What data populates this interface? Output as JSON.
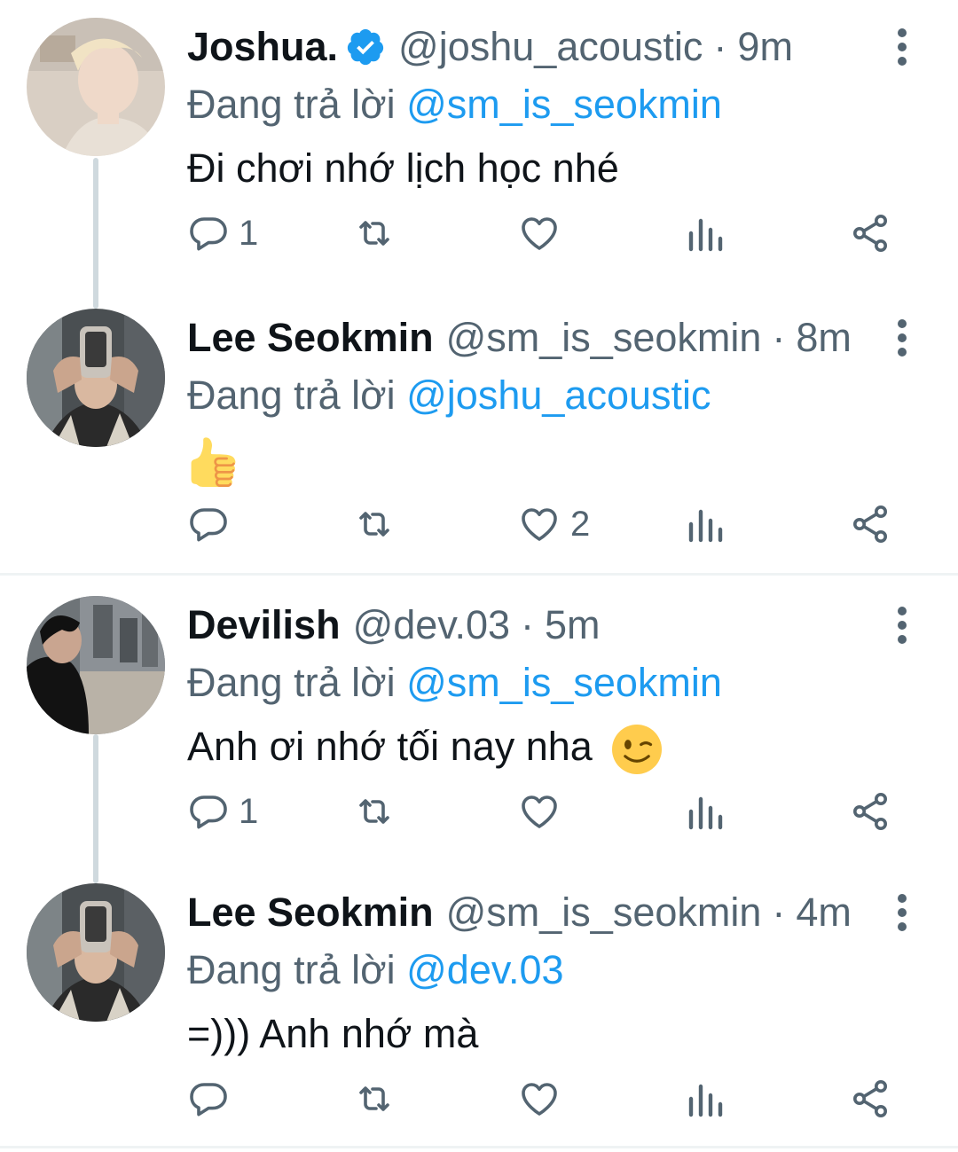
{
  "replying_prefix": "Đang trả lời",
  "colors": {
    "accent": "#1d9bf0",
    "text": "#0f1419",
    "secondary": "#536471",
    "thread_line": "#cfd9de"
  },
  "tweets": [
    {
      "name": "Joshua.",
      "verified": true,
      "handle": "@joshu_acoustic",
      "separator": "·",
      "time": "9m",
      "reply_to": "@sm_is_seokmin",
      "text": "Đi chơi nhớ lịch học nhé",
      "emoji": "",
      "reply_count": "1",
      "retweet_count": "",
      "like_count": "",
      "avatar": "joshua-avatar"
    },
    {
      "name": "Lee Seokmin",
      "verified": false,
      "handle": "@sm_is_seokmin",
      "separator": "·",
      "time": "8m",
      "reply_to": "@joshu_acoustic",
      "text": "",
      "emoji": "thumbs-up-emoji",
      "reply_count": "",
      "retweet_count": "",
      "like_count": "2",
      "avatar": "seokmin-avatar"
    },
    {
      "name": "Devilish",
      "verified": false,
      "handle": "@dev.03",
      "separator": "·",
      "time": "5m",
      "reply_to": "@sm_is_seokmin",
      "text": "Anh ơi nhớ tối nay nha",
      "emoji": "winking-face-emoji",
      "reply_count": "1",
      "retweet_count": "",
      "like_count": "",
      "avatar": "devilish-avatar"
    },
    {
      "name": "Lee Seokmin",
      "verified": false,
      "handle": "@sm_is_seokmin",
      "separator": "·",
      "time": "4m",
      "reply_to": "@dev.03",
      "text": "=))) Anh nhớ mà",
      "emoji": "",
      "reply_count": "",
      "retweet_count": "",
      "like_count": "",
      "avatar": "seokmin-avatar"
    }
  ]
}
